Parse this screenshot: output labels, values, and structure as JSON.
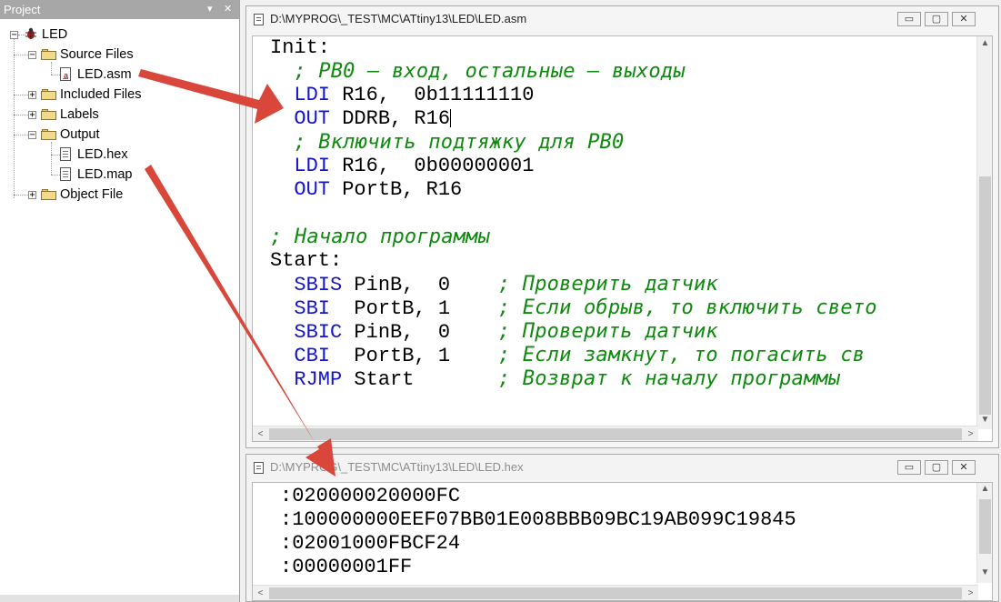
{
  "project_panel": {
    "title": "Project",
    "pin_glyph": "▾",
    "close_glyph": "✕",
    "tree": {
      "root": "LED",
      "source_files": "Source Files",
      "led_asm": "LED.asm",
      "included_files": "Included Files",
      "labels": "Labels",
      "output": "Output",
      "led_hex": "LED.hex",
      "led_map": "LED.map",
      "object_file": "Object File"
    }
  },
  "asm_window": {
    "title": "D:\\MYPROG\\_TEST\\MC\\ATtiny13\\LED\\LED.asm",
    "lines": [
      {
        "label": "Init:"
      },
      {
        "comment": "; PB0 – вход, остальные – выходы"
      },
      {
        "kw": "LDI",
        "args": " R16,  0b11111110"
      },
      {
        "kw": "OUT",
        "args": " DDRB, R16"
      },
      {
        "comment": "; Включить подтяжку для PB0"
      },
      {
        "kw": "LDI",
        "args": " R16,  0b00000001"
      },
      {
        "kw": "OUT",
        "args": " PortB, R16"
      },
      {},
      {
        "comment_label": "; Начало программы"
      },
      {
        "label": "Start:"
      },
      {
        "kw": "SBIS",
        "args": " PinB,  0    ",
        "comment": "; Проверить датчик"
      },
      {
        "kw": "SBI",
        "args": "  PortB, 1    ",
        "comment": "; Если обрыв, то включить свето"
      },
      {
        "kw": "SBIC",
        "args": " PinB,  0    ",
        "comment": "; Проверить датчик"
      },
      {
        "kw": "CBI",
        "args": "  PortB, 1    ",
        "comment": "; Если замкнут, то погасить св"
      },
      {
        "kw": "RJMP",
        "args": " Start       ",
        "comment": "; Возврат к началу программы"
      }
    ]
  },
  "hex_window": {
    "title": "D:\\MYPROG\\_TEST\\MC\\ATtiny13\\LED\\LED.hex",
    "lines": [
      ":020000020000FC",
      ":100000000EEF07BB01E008BBB09BC19AB099C19845",
      ":02001000FBCF24",
      ":00000001FF"
    ]
  },
  "window_buttons": {
    "minimize": "▭",
    "maximize": "▢",
    "close": "✕"
  },
  "scroll": {
    "up": "▲",
    "down": "▼",
    "left": "<",
    "right": ">"
  },
  "colors": {
    "keyword": "#1515c8",
    "comment": "#0f8a0f",
    "arrow": "#d8473a",
    "panel_header": "#a7a7a7"
  }
}
